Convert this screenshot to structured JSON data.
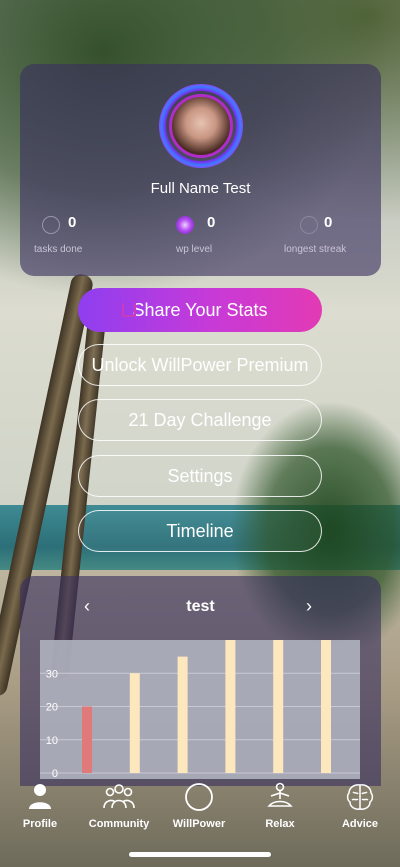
{
  "profile": {
    "name": "Full Name Test",
    "stats": [
      {
        "value": "0",
        "label": "tasks done",
        "icon": "smiley-icon"
      },
      {
        "value": "0",
        "label": "wp level",
        "icon": "purple-orb-icon"
      },
      {
        "value": "0",
        "label": "longest streak",
        "icon": "streak-icon"
      }
    ]
  },
  "buttons": {
    "share": "Share Your Stats",
    "premium": "Unlock WillPower Premium",
    "challenge": "21 Day Challenge",
    "settings": "Settings",
    "timeline": "Timeline"
  },
  "chart_card": {
    "title": "test",
    "prev": "‹",
    "next": "›"
  },
  "chart_data": {
    "type": "bar",
    "title": "test",
    "values": [
      20,
      30,
      35,
      40,
      40,
      40
    ],
    "ylim": [
      0,
      40
    ],
    "yticks": [
      0,
      10,
      20,
      30
    ],
    "grid": true,
    "colors": [
      "#e07a7a",
      "#fde7bd",
      "#fde7bd",
      "#fde7bd",
      "#fde7bd",
      "#fde7bd"
    ]
  },
  "tabs": [
    {
      "label": "Profile",
      "icon": "person-icon"
    },
    {
      "label": "Community",
      "icon": "group-icon"
    },
    {
      "label": "WillPower",
      "icon": "circle-icon"
    },
    {
      "label": "Relax",
      "icon": "meditation-icon"
    },
    {
      "label": "Advice",
      "icon": "brain-icon"
    }
  ]
}
